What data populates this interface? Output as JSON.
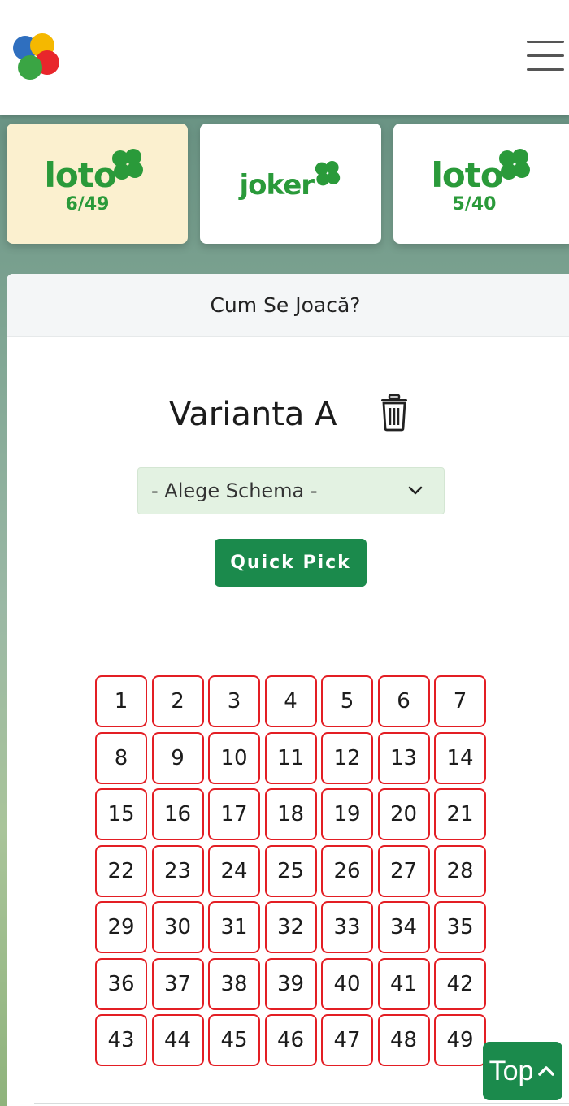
{
  "header": {
    "logo_icon": "lottery-balls-logo",
    "menu_icon": "hamburger-menu-icon"
  },
  "games": [
    {
      "word": "loto",
      "number": "6/49",
      "active": true
    },
    {
      "word": "joker",
      "number": "",
      "active": false
    },
    {
      "word": "loto",
      "number": "5/40",
      "active": false
    }
  ],
  "panel": {
    "how_to_play": "Cum Se Joacă?",
    "variant_title": "Varianta A",
    "delete_icon": "trash-icon",
    "schema_select": "- Alege Schema -",
    "quick_pick": "Quick Pick"
  },
  "numbers": [
    1,
    2,
    3,
    4,
    5,
    6,
    7,
    8,
    9,
    10,
    11,
    12,
    13,
    14,
    15,
    16,
    17,
    18,
    19,
    20,
    21,
    22,
    23,
    24,
    25,
    26,
    27,
    28,
    29,
    30,
    31,
    32,
    33,
    34,
    35,
    36,
    37,
    38,
    39,
    40,
    41,
    42,
    43,
    44,
    45,
    46,
    47,
    48,
    49
  ],
  "top_button": "Top",
  "colors": {
    "brand_green": "#1b8a4c",
    "logo_green": "#2a9a3a",
    "cell_border": "#e31e24",
    "active_card": "#fbf0cf"
  }
}
